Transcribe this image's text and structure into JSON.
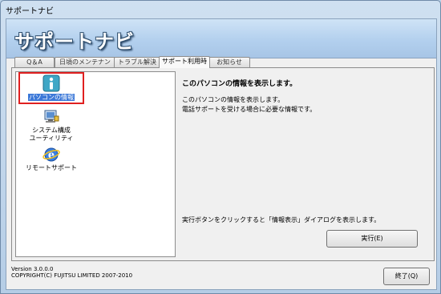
{
  "window": {
    "title": "サポートナビ"
  },
  "header": {
    "app_title": "サポートナビ"
  },
  "tabs": [
    {
      "label": "Q＆A"
    },
    {
      "label": "日頃のメンテナンス"
    },
    {
      "label": "トラブル解決"
    },
    {
      "label": "サポート利用時"
    },
    {
      "label": "お知らせ"
    }
  ],
  "active_tab": "サポート利用時",
  "items": [
    {
      "label": "パソコンの情報",
      "icon": "info-icon",
      "selected": true
    },
    {
      "label_line1": "システム構成",
      "label_line2": "ユーティリティ",
      "icon": "system-config-icon"
    },
    {
      "label": "リモートサポート",
      "icon": "ie-globe-icon"
    }
  ],
  "detail": {
    "heading": "このパソコンの情報を表示します。",
    "line1": "このパソコンの情報を表示します。",
    "line2": "電話サポートを受ける場合に必要な情報です。",
    "instruction": "実行ボタンをクリックすると「情報表示」ダイアログを表示します。",
    "run_button": "実行(E)"
  },
  "footer": {
    "version": "Version 3.0.0.0",
    "copyright": "COPYRIGHT(C) FUJITSU LIMITED 2007-2010",
    "exit_button": "終了(Q)"
  },
  "colors": {
    "selection_outline": "#e02020",
    "selection_bg": "#3b78d8"
  }
}
